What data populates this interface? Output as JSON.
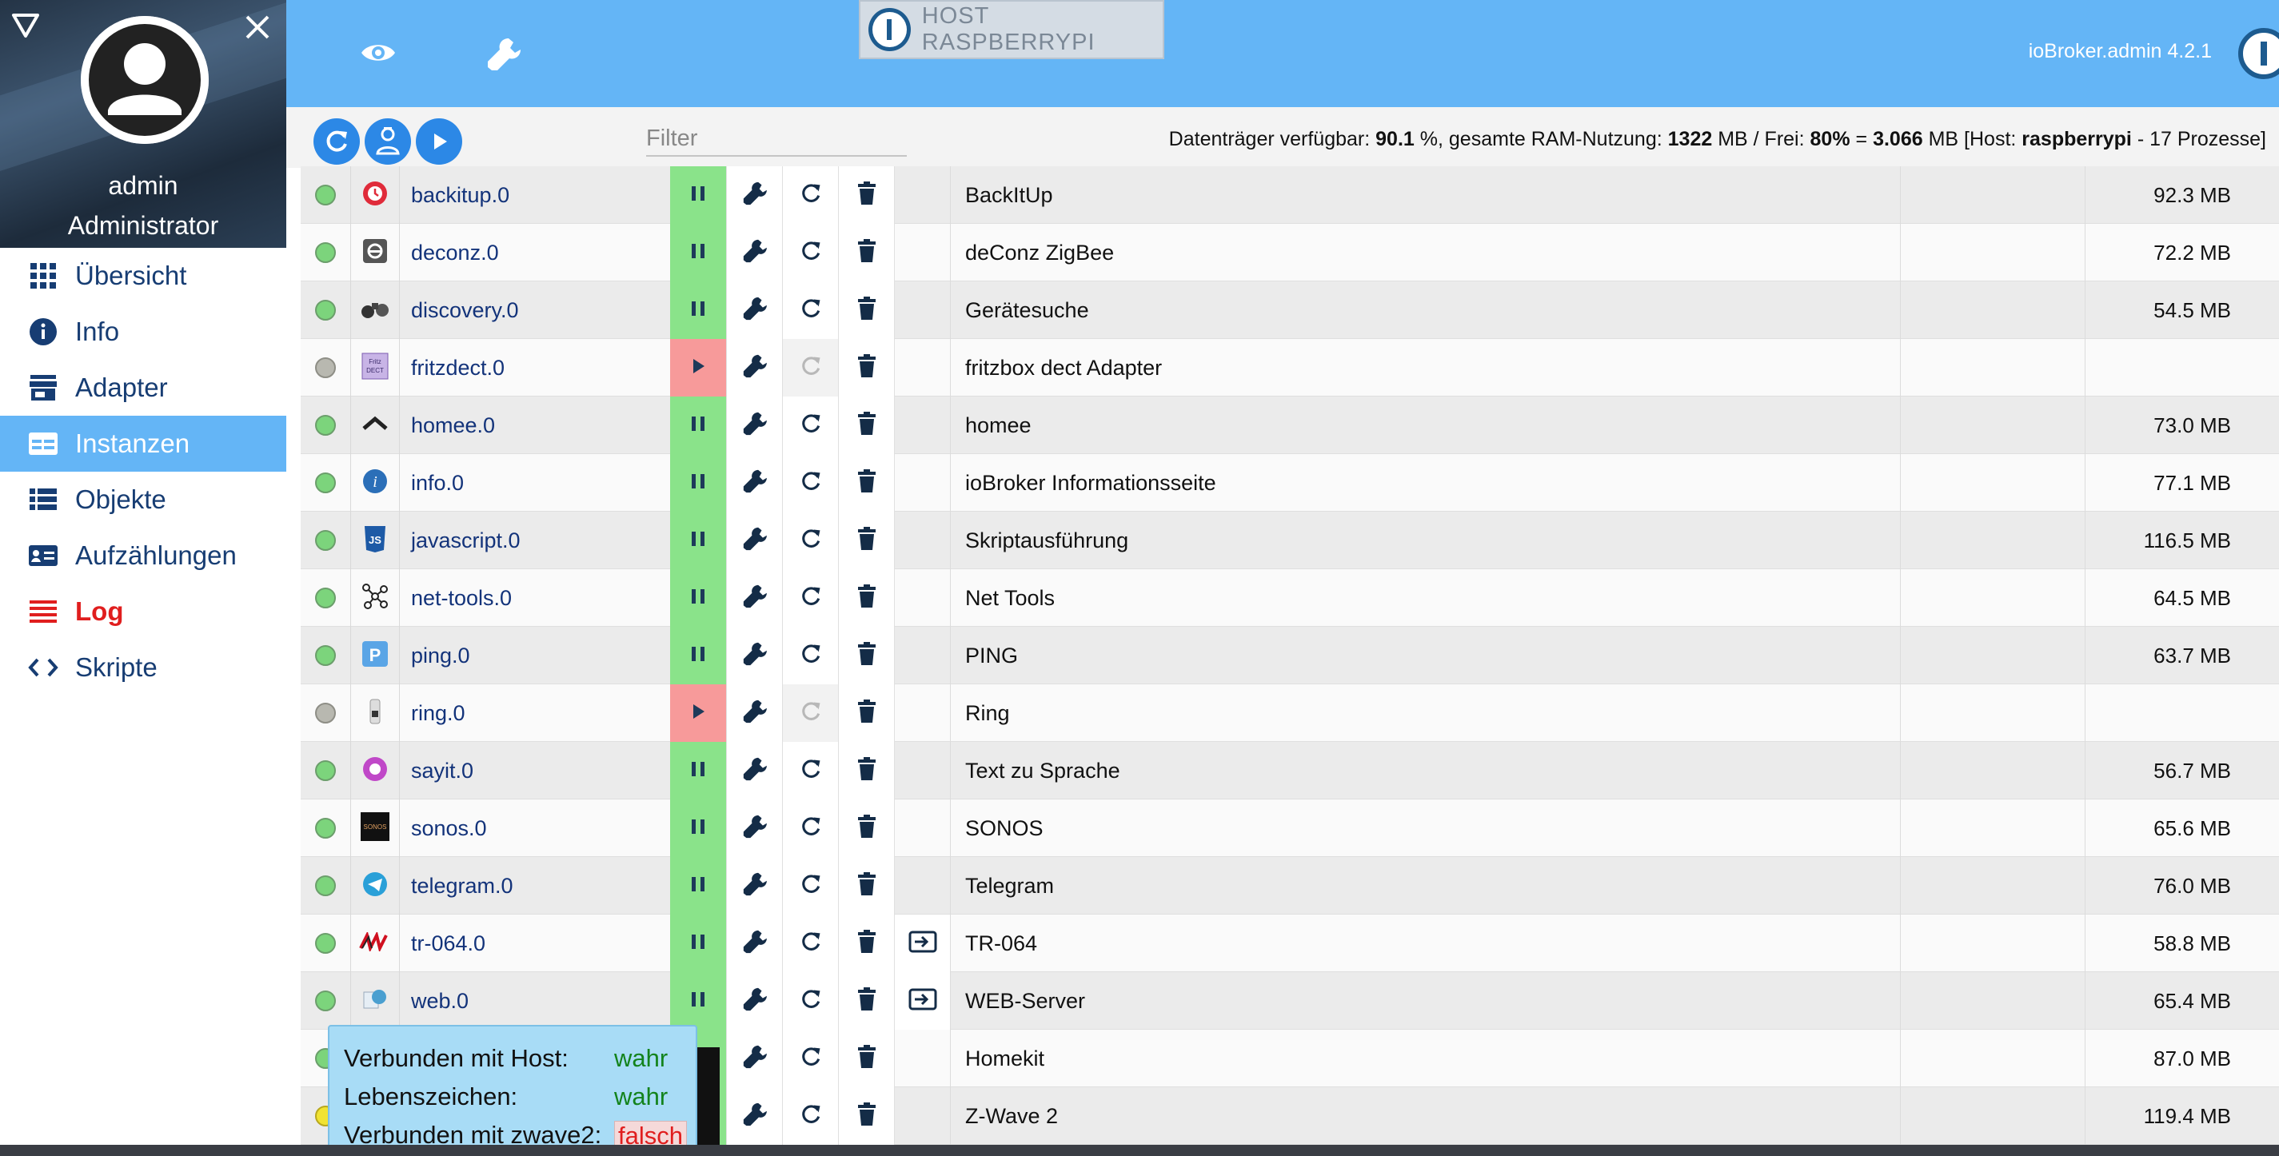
{
  "sidebar": {
    "user": {
      "name": "admin",
      "role": "Administrator"
    },
    "items": [
      {
        "key": "overview",
        "label": "Übersicht",
        "icon": "grid-icon",
        "active": false
      },
      {
        "key": "info",
        "label": "Info",
        "icon": "info-circle-icon",
        "active": false
      },
      {
        "key": "adapters",
        "label": "Adapter",
        "icon": "store-icon",
        "active": false
      },
      {
        "key": "instances",
        "label": "Instanzen",
        "icon": "instances-icon",
        "active": true
      },
      {
        "key": "objects",
        "label": "Objekte",
        "icon": "list-icon",
        "active": false
      },
      {
        "key": "enums",
        "label": "Aufzählungen",
        "icon": "enum-card-icon",
        "active": false
      },
      {
        "key": "log",
        "label": "Log",
        "icon": "log-lines-icon",
        "active": false
      },
      {
        "key": "scripts",
        "label": "Skripte",
        "icon": "code-icon",
        "active": false
      }
    ]
  },
  "header": {
    "host_label": "HOST RASPBERRYPI",
    "version": "ioBroker.admin 4.2.1"
  },
  "toolbar": {
    "filter_placeholder": "Filter",
    "stats": {
      "disk_label": "Datenträger verfügbar:",
      "disk_value": "90.1",
      "ram_label": "%, gesamte RAM-Nutzung:",
      "ram_value": "1322",
      "free_label": "MB / Frei:",
      "free_pct": "80%",
      "eq": "=",
      "free_mb": "3.066",
      "host_prefix": "MB [Host:",
      "host_name": "raspberrypi",
      "procs": "- 17 Prozesse]"
    }
  },
  "instances": [
    {
      "name": "backitup.0",
      "desc": "BackItUp",
      "ram": "92.3 MB",
      "status": "green",
      "running": true,
      "extra": false,
      "icon": "backitup-icon"
    },
    {
      "name": "deconz.0",
      "desc": "deConz ZigBee",
      "ram": "72.2 MB",
      "status": "green",
      "running": true,
      "extra": false,
      "icon": "deconz-icon"
    },
    {
      "name": "discovery.0",
      "desc": "Gerätesuche",
      "ram": "54.5 MB",
      "status": "green",
      "running": true,
      "extra": false,
      "icon": "binoculars-icon"
    },
    {
      "name": "fritzdect.0",
      "desc": "fritzbox dect Adapter",
      "ram": "",
      "status": "grey",
      "running": false,
      "extra": false,
      "icon": "fritzdect-icon",
      "icon_text": "Fritz DECT"
    },
    {
      "name": "homee.0",
      "desc": "homee",
      "ram": "73.0 MB",
      "status": "green",
      "running": true,
      "extra": false,
      "icon": "homee-icon"
    },
    {
      "name": "info.0",
      "desc": "ioBroker Informationsseite",
      "ram": "77.1 MB",
      "status": "green",
      "running": true,
      "extra": false,
      "icon": "info-adapter-icon"
    },
    {
      "name": "javascript.0",
      "desc": "Skriptausführung",
      "ram": "116.5 MB",
      "status": "green",
      "running": true,
      "extra": false,
      "icon": "javascript-icon",
      "icon_text": "JS"
    },
    {
      "name": "net-tools.0",
      "desc": "Net Tools",
      "ram": "64.5 MB",
      "status": "green",
      "running": true,
      "extra": false,
      "icon": "network-icon"
    },
    {
      "name": "ping.0",
      "desc": "PING",
      "ram": "63.7 MB",
      "status": "green",
      "running": true,
      "extra": false,
      "icon": "ping-icon",
      "icon_text": "P"
    },
    {
      "name": "ring.0",
      "desc": "Ring",
      "ram": "",
      "status": "grey",
      "running": false,
      "extra": false,
      "icon": "ring-icon"
    },
    {
      "name": "sayit.0",
      "desc": "Text zu Sprache",
      "ram": "56.7 MB",
      "status": "green",
      "running": true,
      "extra": false,
      "icon": "sayit-icon"
    },
    {
      "name": "sonos.0",
      "desc": "SONOS",
      "ram": "65.6 MB",
      "status": "green",
      "running": true,
      "extra": false,
      "icon": "sonos-icon",
      "icon_text": "SONOS"
    },
    {
      "name": "telegram.0",
      "desc": "Telegram",
      "ram": "76.0 MB",
      "status": "green",
      "running": true,
      "extra": false,
      "icon": "telegram-icon"
    },
    {
      "name": "tr-064.0",
      "desc": "TR-064",
      "ram": "58.8 MB",
      "status": "green",
      "running": true,
      "extra": true,
      "icon": "avm-icon",
      "icon_text": "AVM"
    },
    {
      "name": "web.0",
      "desc": "WEB-Server",
      "ram": "65.4 MB",
      "status": "green",
      "running": true,
      "extra": true,
      "icon": "web-icon"
    },
    {
      "name": "",
      "desc": "Homekit",
      "ram": "87.0 MB",
      "status": "green",
      "running": true,
      "extra": false,
      "icon": "homekit-icon"
    },
    {
      "name": "",
      "desc": "Z-Wave 2",
      "ram": "119.4 MB",
      "status": "yellow",
      "running": true,
      "extra": false,
      "icon": "zwave-icon"
    }
  ],
  "tooltip": {
    "rows": [
      {
        "key": "Verbunden mit Host:",
        "value": "wahr",
        "ok": true
      },
      {
        "key": "Lebenszeichen:",
        "value": "wahr",
        "ok": true
      },
      {
        "key": "Verbunden mit zwave2:",
        "value": "falsch",
        "ok": false
      }
    ]
  },
  "colors": {
    "accent": "#64b5f6",
    "run": "#8ae38a",
    "stopped": "#f79a9a",
    "link": "#13337a",
    "log": "#e01e1e"
  }
}
